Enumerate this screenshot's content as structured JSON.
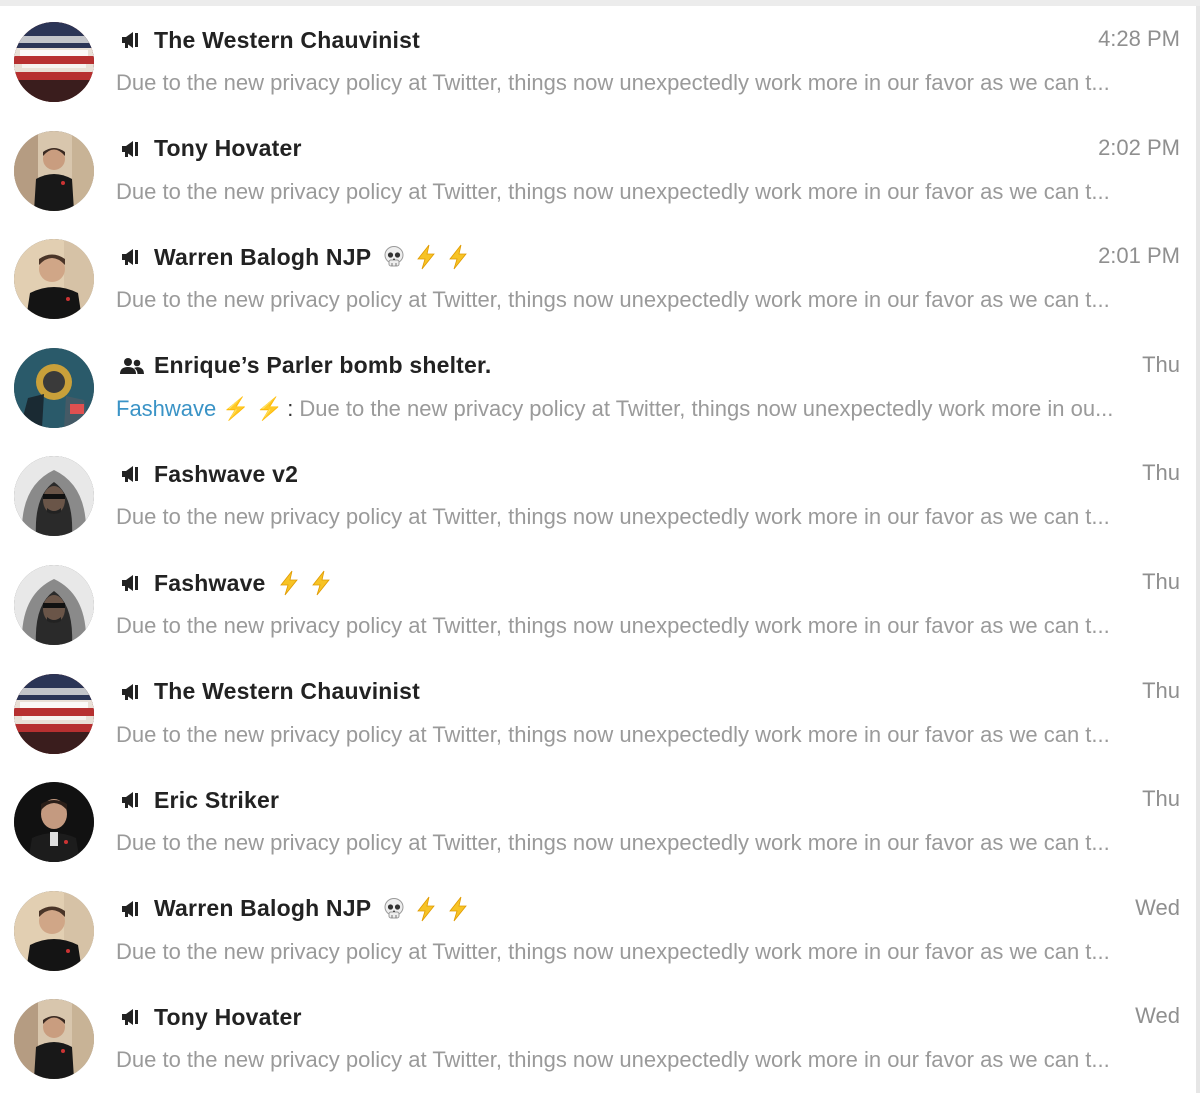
{
  "chats": [
    {
      "name": "The Western Chauvinist",
      "type": "channel",
      "emojis": [],
      "time": "4:28 PM",
      "sender": "",
      "preview": "Due to the new privacy policy at Twitter, things now unexpectedly work more in our favor as we can t...",
      "avatar": "flag-avatar"
    },
    {
      "name": "Tony Hovater",
      "type": "channel",
      "emojis": [],
      "time": "2:02 PM",
      "sender": "",
      "preview": "Due to the new privacy policy at Twitter, things now unexpectedly work more in our favor as we can t...",
      "avatar": "man-avatar"
    },
    {
      "name": "Warren Balogh NJP",
      "type": "channel",
      "emojis": [
        "skull",
        "zap",
        "zap"
      ],
      "time": "2:01 PM",
      "sender": "",
      "preview": "Due to the new privacy policy at Twitter, things now unexpectedly work more in our favor as we can t...",
      "avatar": "man2-avatar"
    },
    {
      "name": "Enrique’s Parler bomb shelter.",
      "type": "group",
      "emojis": [],
      "time": "Thu",
      "sender": "Fashwave ⚡ ⚡",
      "preview": "Due to the new privacy policy at Twitter, things now unexpectedly work more in ou...",
      "avatar": "group-avatar"
    },
    {
      "name": "Fashwave v2",
      "type": "channel",
      "emojis": [],
      "time": "Thu",
      "sender": "",
      "preview": "Due to the new privacy policy at Twitter, things now unexpectedly work more in our favor as we can t...",
      "avatar": "hood-avatar"
    },
    {
      "name": "Fashwave",
      "type": "channel",
      "emojis": [
        "zap",
        "zap"
      ],
      "time": "Thu",
      "sender": "",
      "preview": "Due to the new privacy policy at Twitter, things now unexpectedly work more in our favor as we can t...",
      "avatar": "hood-avatar"
    },
    {
      "name": "The Western Chauvinist",
      "type": "channel",
      "emojis": [],
      "time": "Thu",
      "sender": "",
      "preview": "Due to the new privacy policy at Twitter, things now unexpectedly work more in our favor as we can t...",
      "avatar": "flag-avatar"
    },
    {
      "name": "Eric Striker",
      "type": "channel",
      "emojis": [],
      "time": "Thu",
      "sender": "",
      "preview": "Due to the new privacy policy at Twitter, things now unexpectedly work more in our favor as we can t...",
      "avatar": "dark-avatar"
    },
    {
      "name": "Warren Balogh NJP",
      "type": "channel",
      "emojis": [
        "skull",
        "zap",
        "zap"
      ],
      "time": "Wed",
      "sender": "",
      "preview": "Due to the new privacy policy at Twitter, things now unexpectedly work more in our favor as we can t...",
      "avatar": "man2-avatar"
    },
    {
      "name": "Tony Hovater",
      "type": "channel",
      "emojis": [],
      "time": "Wed",
      "sender": "",
      "preview": "Due to the new privacy policy at Twitter, things now unexpectedly work more in our favor as we can t...",
      "avatar": "man-avatar"
    }
  ],
  "colors": {
    "sender": "#3a93c6",
    "time": "#8f8f8f",
    "preview": "#9a9a9a",
    "name": "#222222"
  }
}
